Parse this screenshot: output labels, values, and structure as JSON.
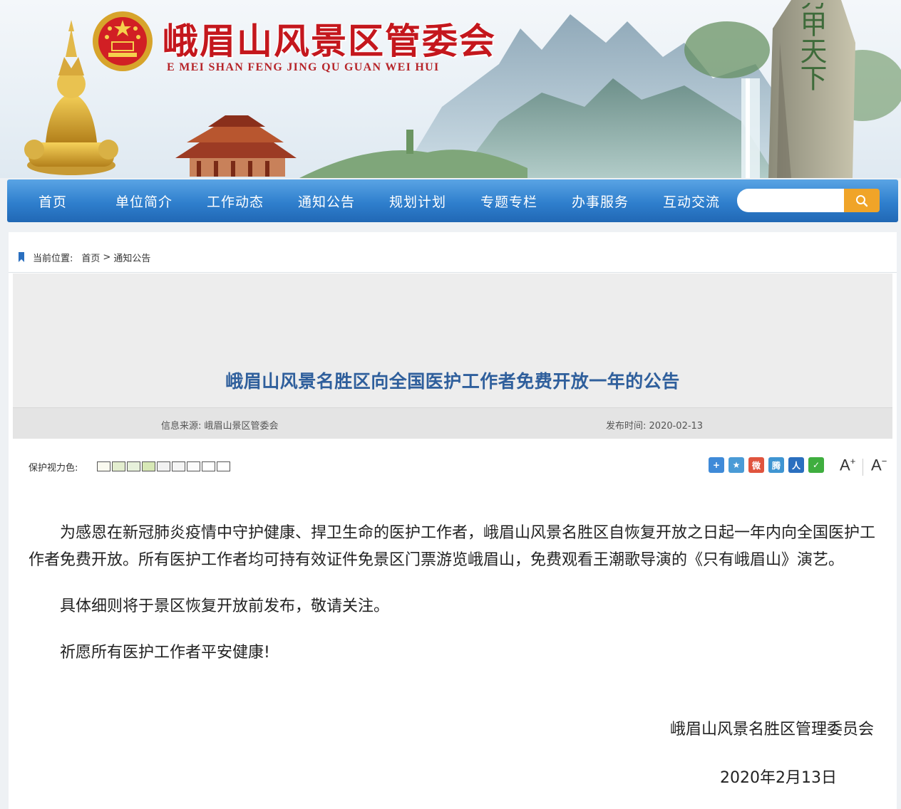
{
  "header": {
    "title": "峨眉山风景区管委会",
    "subtitle": "E MEI SHAN FENG JING QU GUAN WEI HUI",
    "emblem_icon": "national-emblem",
    "rock_calligraphy": "秀甲天下"
  },
  "nav": {
    "items": [
      "首页",
      "单位简介",
      "工作动态",
      "通知公告",
      "规划计划",
      "专题专栏",
      "办事服务",
      "互动交流"
    ],
    "search_placeholder": "",
    "search_icon": "magnifier-icon"
  },
  "breadcrumb": {
    "label": "当前位置:",
    "home": "首页",
    "separator": ">",
    "current": "通知公告"
  },
  "article": {
    "title": "峨眉山风景名胜区向全国医护工作者免费开放一年的公告",
    "source_label": "信息来源:",
    "source": "峨眉山景区管委会",
    "date_label": "发布时间:",
    "date": "2020-02-13",
    "paragraphs": [
      "为感恩在新冠肺炎疫情中守护健康、捍卫生命的医护工作者，峨眉山风景名胜区自恢复开放之日起一年内向全国医护工作者免费开放。所有医护工作者均可持有效证件免景区门票游览峨眉山，免费观看王潮歌导演的《只有峨眉山》演艺。",
      "具体细则将于景区恢复开放前发布，敬请关注。",
      "祈愿所有医护工作者平安健康!"
    ],
    "signature": "峨眉山风景名胜区管理委员会",
    "sign_date": "2020年2月13日"
  },
  "tools": {
    "color_label": "保护视力色:",
    "swatch_colors": [
      "#fafaf0",
      "#e3eecf",
      "#e7f1db",
      "#d7e8b6",
      "#f2f2f2",
      "#f5f5f5",
      "#fbfbfb",
      "#ffffff",
      "#ffffff"
    ],
    "share": [
      {
        "icon": "qzone-share-icon",
        "glyph": "+",
        "color": "#3f8ad8"
      },
      {
        "icon": "qq-share-icon",
        "glyph": "★",
        "color": "#4a9bd6"
      },
      {
        "icon": "weibo-share-icon",
        "glyph": "微",
        "color": "#e0543e"
      },
      {
        "icon": "tencent-weibo-share-icon",
        "glyph": "腾",
        "color": "#3f95d2"
      },
      {
        "icon": "renren-share-icon",
        "glyph": "人",
        "color": "#2a6fbf"
      },
      {
        "icon": "wechat-share-icon",
        "glyph": "✓",
        "color": "#3fae3f"
      }
    ],
    "font_increase": "A",
    "font_decrease": "A"
  }
}
